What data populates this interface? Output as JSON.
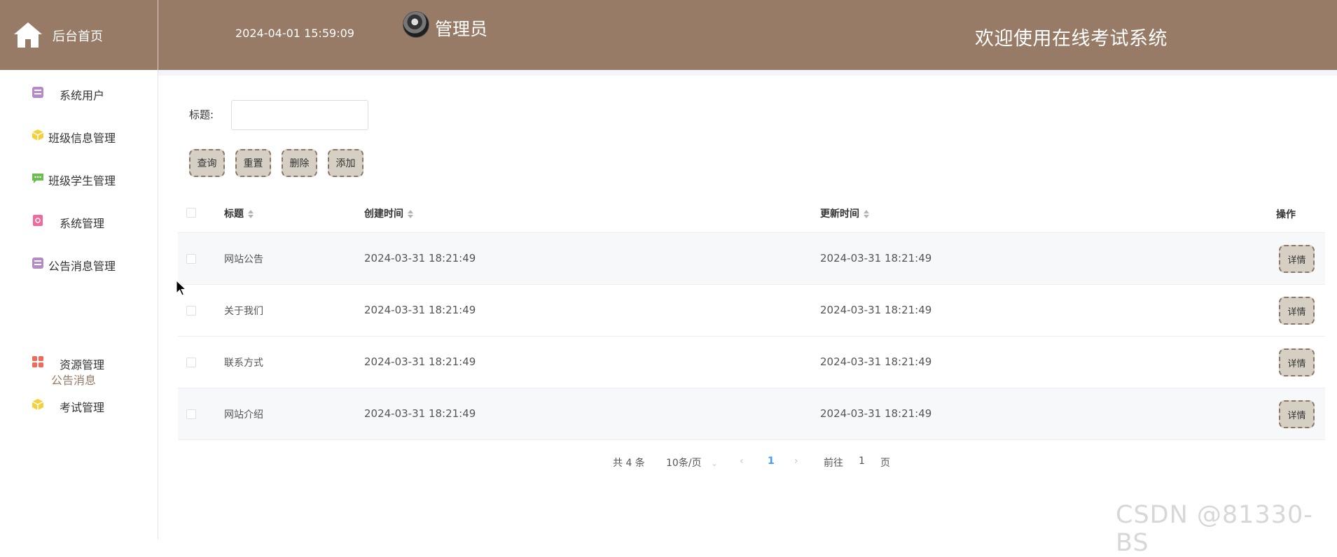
{
  "header": {
    "home_label": "后台首页",
    "datetime": "2024-04-01 15:59:09",
    "admin_name": "管理员",
    "welcome": "欢迎使用在线考试系统",
    "background_color": "#987b66"
  },
  "sidebar": {
    "items": [
      {
        "label": "系统用户",
        "icon": "archive-icon",
        "color": "#b58bc6"
      },
      {
        "label": "班级信息管理",
        "icon": "cube-icon",
        "color": "#f4d03f"
      },
      {
        "label": "班级学生管理",
        "icon": "message-icon",
        "color": "#6cbf4f"
      },
      {
        "label": "系统管理",
        "icon": "settings-card-icon",
        "color": "#f06aa0"
      },
      {
        "label": "公告消息管理",
        "icon": "archive-icon",
        "color": "#b58bc6"
      },
      {
        "label": "资源管理",
        "icon": "grid-icon",
        "color": "#f06a5a"
      },
      {
        "label": "考试管理",
        "icon": "cube-icon",
        "color": "#f4d03f"
      }
    ],
    "sub_item": "公告消息"
  },
  "search": {
    "title_label": "标题:",
    "title_value": "",
    "buttons": {
      "query": "查询",
      "reset": "重置",
      "delete": "删除",
      "add": "添加"
    }
  },
  "table": {
    "headers": {
      "title": "标题",
      "created": "创建时间",
      "updated": "更新时间",
      "actions": "操作"
    },
    "rows": [
      {
        "title": "网站公告",
        "created": "2024-03-31 18:21:49",
        "updated": "2024-03-31 18:21:49",
        "action": "详情"
      },
      {
        "title": "关于我们",
        "created": "2024-03-31 18:21:49",
        "updated": "2024-03-31 18:21:49",
        "action": "详情"
      },
      {
        "title": "联系方式",
        "created": "2024-03-31 18:21:49",
        "updated": "2024-03-31 18:21:49",
        "action": "详情"
      },
      {
        "title": "网站介绍",
        "created": "2024-03-31 18:21:49",
        "updated": "2024-03-31 18:21:49",
        "action": "详情"
      }
    ]
  },
  "pagination": {
    "total": "共 4 条",
    "page_size": "10条/页",
    "current_page": "1",
    "goto_prefix": "前往",
    "goto_value": "1",
    "goto_suffix": "页"
  },
  "watermark": "CSDN @81330-BS"
}
